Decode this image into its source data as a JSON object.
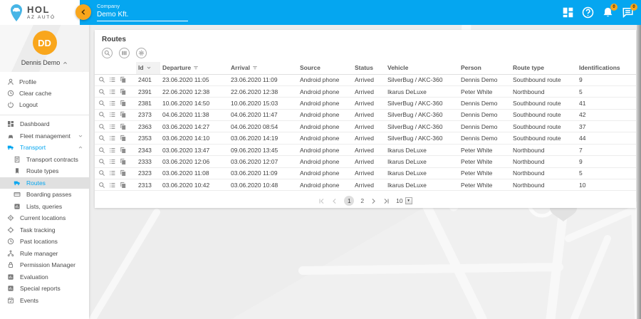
{
  "header": {
    "logo_line1": "HOL",
    "logo_line2": "AZ AUTÓ",
    "company_label": "Company",
    "company_value": "Demo Kft.",
    "badges": {
      "notifications": "0",
      "messages": "0"
    }
  },
  "sidebar": {
    "user": {
      "initials": "DD",
      "name": "Dennis Demo"
    },
    "account_items": [
      {
        "label": "Profile"
      },
      {
        "label": "Clear cache"
      },
      {
        "label": "Logout"
      }
    ],
    "menu": [
      {
        "label": "Dashboard"
      },
      {
        "label": "Fleet management"
      },
      {
        "label": "Transport"
      },
      {
        "label": "Transport contracts"
      },
      {
        "label": "Route types"
      },
      {
        "label": "Routes"
      },
      {
        "label": "Boarding passes"
      },
      {
        "label": "Lists, queries"
      },
      {
        "label": "Current locations"
      },
      {
        "label": "Task tracking"
      },
      {
        "label": "Past locations"
      },
      {
        "label": "Rule manager"
      },
      {
        "label": "Permission Manager"
      },
      {
        "label": "Evaluation"
      },
      {
        "label": "Special reports"
      },
      {
        "label": "Events"
      }
    ]
  },
  "panel": {
    "title": "Routes",
    "toolbar_icons": [
      "search",
      "columns",
      "settings"
    ],
    "columns": {
      "id": "Id",
      "departure": "Departure",
      "arrival": "Arrival",
      "source": "Source",
      "status": "Status",
      "vehicle": "Vehicle",
      "person": "Person",
      "route_type": "Route type",
      "identifications": "Identifications"
    },
    "rows": [
      {
        "id": "2401",
        "departure": "23.06.2020 11:05",
        "arrival": "23.06.2020 11:09",
        "source": "Android phone",
        "status": "Arrived",
        "vehicle": "SilverBug / AKC-360",
        "person": "Dennis Demo",
        "route_type": "Southbound route",
        "identifications": "9"
      },
      {
        "id": "2391",
        "departure": "22.06.2020 12:38",
        "arrival": "22.06.2020 12:38",
        "source": "Android phone",
        "status": "Arrived",
        "vehicle": "Ikarus DeLuxe",
        "person": "Peter White",
        "route_type": "Northbound",
        "identifications": "5"
      },
      {
        "id": "2381",
        "departure": "10.06.2020 14:50",
        "arrival": "10.06.2020 15:03",
        "source": "Android phone",
        "status": "Arrived",
        "vehicle": "SilverBug / AKC-360",
        "person": "Dennis Demo",
        "route_type": "Southbound route",
        "identifications": "41"
      },
      {
        "id": "2373",
        "departure": "04.06.2020 11:38",
        "arrival": "04.06.2020 11:47",
        "source": "Android phone",
        "status": "Arrived",
        "vehicle": "SilverBug / AKC-360",
        "person": "Dennis Demo",
        "route_type": "Southbound route",
        "identifications": "42"
      },
      {
        "id": "2363",
        "departure": "03.06.2020 14:27",
        "arrival": "04.06.2020 08:54",
        "source": "Android phone",
        "status": "Arrived",
        "vehicle": "SilverBug / AKC-360",
        "person": "Dennis Demo",
        "route_type": "Southbound route",
        "identifications": "37"
      },
      {
        "id": "2353",
        "departure": "03.06.2020 14:10",
        "arrival": "03.06.2020 14:19",
        "source": "Android phone",
        "status": "Arrived",
        "vehicle": "SilverBug / AKC-360",
        "person": "Dennis Demo",
        "route_type": "Southbound route",
        "identifications": "44"
      },
      {
        "id": "2343",
        "departure": "03.06.2020 13:47",
        "arrival": "09.06.2020 13:45",
        "source": "Android phone",
        "status": "Arrived",
        "vehicle": "Ikarus DeLuxe",
        "person": "Peter White",
        "route_type": "Northbound",
        "identifications": "7"
      },
      {
        "id": "2333",
        "departure": "03.06.2020 12:06",
        "arrival": "03.06.2020 12:07",
        "source": "Android phone",
        "status": "Arrived",
        "vehicle": "Ikarus DeLuxe",
        "person": "Peter White",
        "route_type": "Northbound",
        "identifications": "9"
      },
      {
        "id": "2323",
        "departure": "03.06.2020 11:08",
        "arrival": "03.06.2020 11:09",
        "source": "Android phone",
        "status": "Arrived",
        "vehicle": "Ikarus DeLuxe",
        "person": "Peter White",
        "route_type": "Northbound",
        "identifications": "5"
      },
      {
        "id": "2313",
        "departure": "03.06.2020 10:42",
        "arrival": "03.06.2020 10:48",
        "source": "Android phone",
        "status": "Arrived",
        "vehicle": "Ikarus DeLuxe",
        "person": "Peter White",
        "route_type": "Northbound",
        "identifications": "10"
      }
    ],
    "pagination": {
      "page1": "1",
      "page2": "2",
      "current": "1",
      "page_size": "10"
    }
  },
  "colors": {
    "accent": "#05a6f0",
    "orange": "#f9a61c",
    "selected_bg": "#e0e0e0"
  }
}
